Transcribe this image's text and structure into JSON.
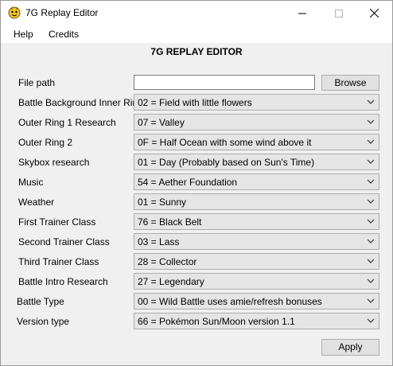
{
  "window": {
    "title": "7G Replay Editor"
  },
  "menu": {
    "help": "Help",
    "credits": "Credits"
  },
  "heading": "7G REPLAY EDITOR",
  "file": {
    "label": "File path",
    "value": "",
    "browse": "Browse"
  },
  "fields": [
    {
      "label": "Battle Background Inner Ring",
      "value": "02 = Field with little flowers"
    },
    {
      "label": "Outer Ring 1 Research",
      "value": "07 = Valley"
    },
    {
      "label": "Outer Ring 2",
      "value": "0F = Half Ocean with some wind above it"
    },
    {
      "label": "Skybox research",
      "value": "01 = Day (Probably based on Sun's Time)"
    },
    {
      "label": "Music",
      "value": "54 = Aether Foundation"
    },
    {
      "label": "Weather",
      "value": "01 = Sunny"
    },
    {
      "label": "First Trainer Class",
      "value": "76 = Black Belt"
    },
    {
      "label": "Second Trainer Class",
      "value": "03 = Lass"
    },
    {
      "label": "Third Trainer Class",
      "value": "28 = Collector"
    },
    {
      "label": "Battle Intro Research",
      "value": "27 = Legendary"
    },
    {
      "label": "Battle Type",
      "value": "00 = Wild Battle uses amie/refresh bonuses"
    },
    {
      "label": "Version type",
      "value": "66 = Pokémon Sun/Moon version 1.1"
    }
  ],
  "apply": "Apply"
}
